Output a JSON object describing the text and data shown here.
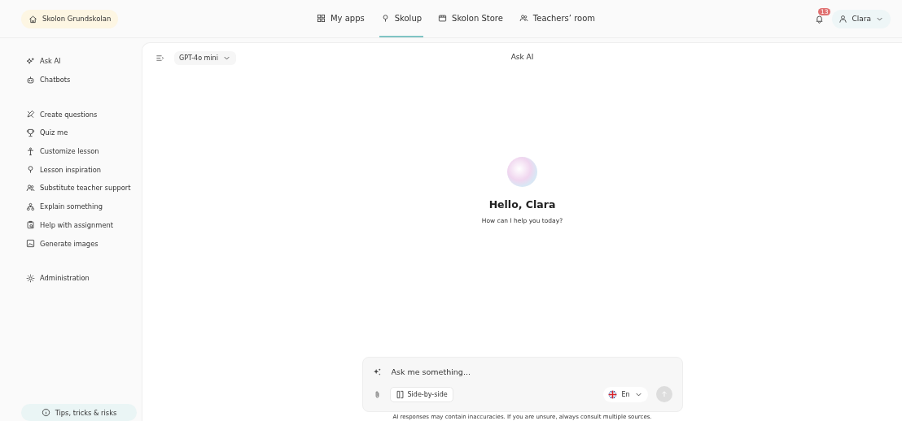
{
  "school": {
    "label": "Skolon Grundskolan"
  },
  "nav_tabs": [
    {
      "label": "My apps",
      "selected": false
    },
    {
      "label": "Skolup",
      "selected": true
    },
    {
      "label": "Skolon Store",
      "selected": false
    },
    {
      "label": "Teachers’ room",
      "selected": false
    }
  ],
  "notifications": {
    "count": "13"
  },
  "user": {
    "name": "Clara"
  },
  "sidebar": {
    "groups": [
      [
        {
          "label": "Ask AI"
        },
        {
          "label": "Chatbots"
        }
      ],
      [
        {
          "label": "Create questions"
        },
        {
          "label": "Quiz me"
        },
        {
          "label": "Customize lesson"
        },
        {
          "label": "Lesson inspiration"
        },
        {
          "label": "Substitute teacher support"
        },
        {
          "label": "Explain something"
        },
        {
          "label": "Help with assignment"
        },
        {
          "label": "Generate images"
        }
      ],
      [
        {
          "label": "Administration"
        }
      ]
    ],
    "tips": "Tips, tricks & risks"
  },
  "chat": {
    "model": "GPT-4o mini",
    "title": "Ask AI",
    "greeting": "Hello, Clara",
    "subtitle": "How can I help you today?",
    "input": {
      "placeholder": "Ask me something..."
    },
    "side_by_side": "Side-by-side",
    "language": "En",
    "disclaimer": "AI responses may contain inaccuracies. If you are unsure, always consult multiple sources."
  }
}
